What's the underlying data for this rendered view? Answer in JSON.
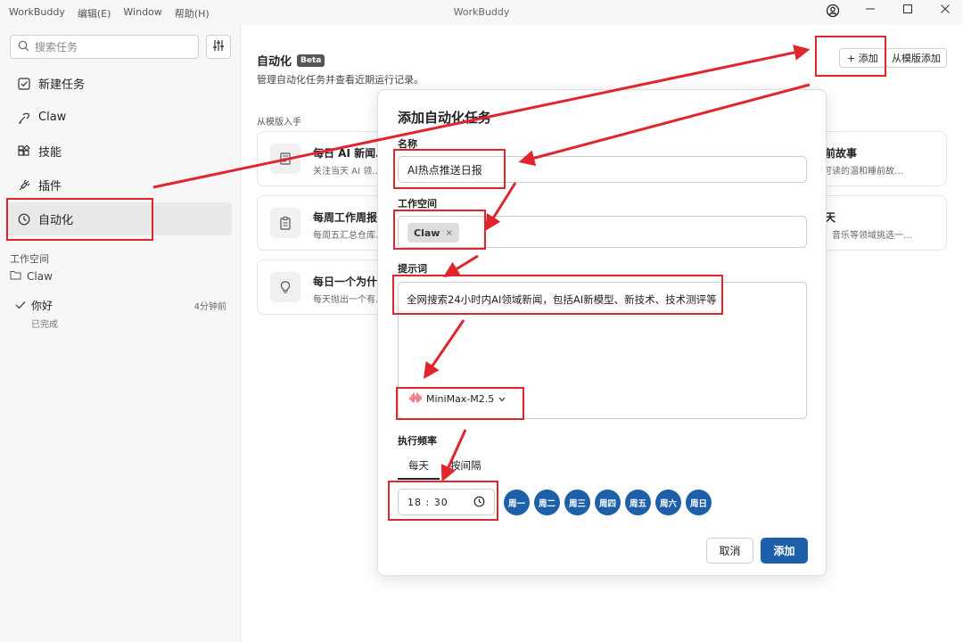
{
  "window": {
    "title": "WorkBuddy",
    "menu": [
      "WorkBuddy",
      "编辑(E)",
      "Window",
      "帮助(H)"
    ],
    "controls": [
      "account-icon",
      "minimize-icon",
      "maximize-icon",
      "close-icon"
    ]
  },
  "sidebar": {
    "search_placeholder": "搜索任务",
    "items": [
      {
        "label": "新建任务",
        "icon": "new-task-icon"
      },
      {
        "label": "Claw",
        "icon": "claw-icon"
      },
      {
        "label": "技能",
        "icon": "skills-icon"
      },
      {
        "label": "插件",
        "icon": "plugin-icon"
      },
      {
        "label": "自动化",
        "icon": "clock-icon",
        "active": true
      }
    ],
    "workspace_title": "工作空间",
    "workspace_item": "Claw",
    "task": {
      "title": "你好",
      "time": "4分钟前",
      "status": "已完成"
    }
  },
  "main": {
    "title": "自动化",
    "badge": "Beta",
    "subtitle": "管理自动化任务并查看近期运行记录。",
    "add_button": "+ 添加",
    "template_button": "从模版添加",
    "section_label": "从模版入手",
    "cards": [
      {
        "title": "每日 AI 新闻…",
        "desc": "关注当天 AI 领…"
      },
      {
        "title": "每周工作周报",
        "desc": "每周五汇总仓库…"
      },
      {
        "title": "每日一个为什…",
        "desc": "每天抛出一个有…"
      }
    ],
    "right_cards": [
      {
        "title": "睡前故事",
        "desc": "钟可读的温和睡前故…"
      },
      {
        "title": "今天",
        "desc": "影、音乐等领域挑选一…"
      }
    ]
  },
  "modal": {
    "title": "添加自动化任务",
    "name_label": "名称",
    "name_value": "AI热点推送日报",
    "workspace_label": "工作空间",
    "workspace_chip": "Claw",
    "chip_close": "×",
    "prompt_label": "提示词",
    "prompt_value": "全网搜索24小时内AI领域新闻，包括AI新模型、新技术、技术测评等",
    "model": "MiniMax-M2.5",
    "frequency_label": "执行频率",
    "tabs": [
      "每天",
      "按间隔"
    ],
    "time_value": "18 : 30",
    "days": [
      "周一",
      "周二",
      "周三",
      "周四",
      "周五",
      "周六",
      "周日"
    ],
    "cancel": "取消",
    "confirm": "添加"
  },
  "colors": {
    "accent": "#1d5fa8",
    "annotation": "#e0252c"
  }
}
